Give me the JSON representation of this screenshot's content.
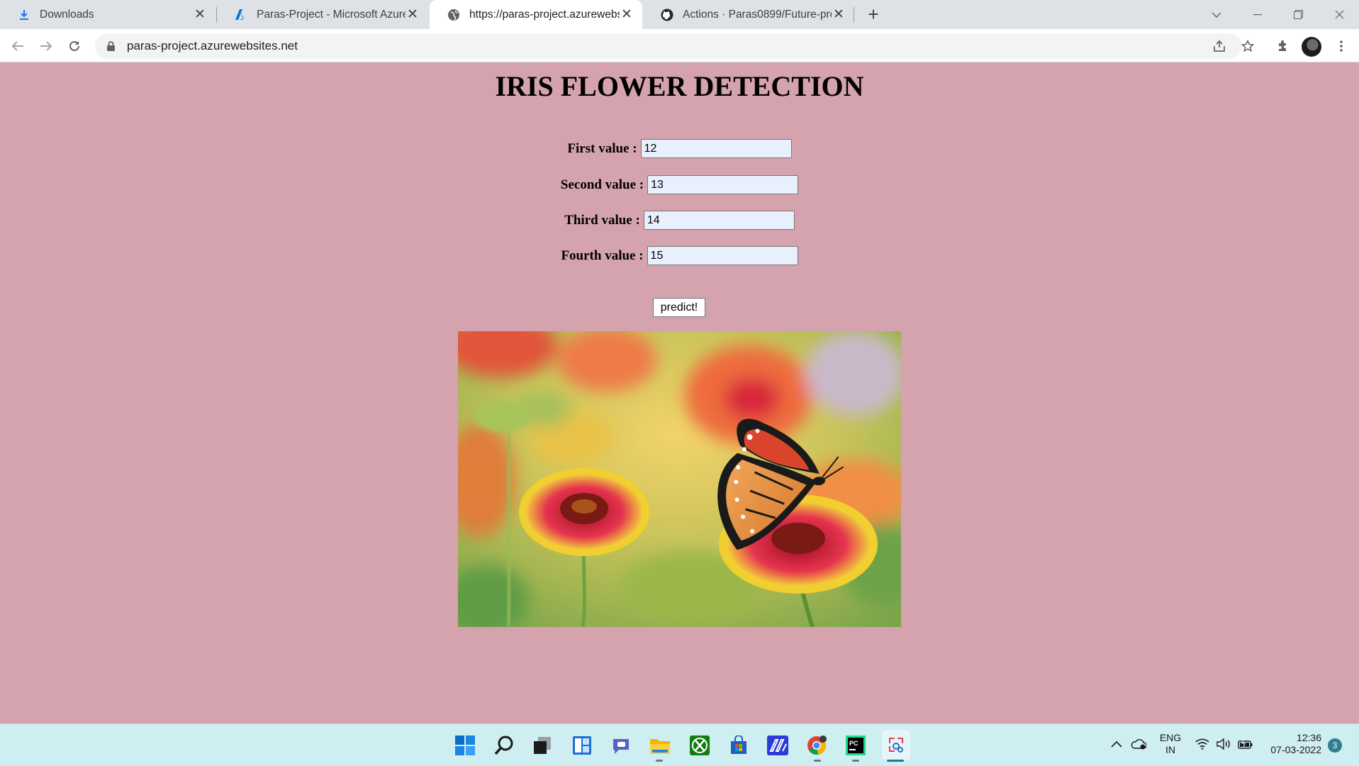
{
  "browser": {
    "tabs": [
      {
        "title": "Downloads",
        "favicon": "download-icon"
      },
      {
        "title": "Paras-Project - Microsoft Azure",
        "favicon": "azure-icon"
      },
      {
        "title": "https://paras-project.azurewebsit",
        "favicon": "globe-icon",
        "active": true
      },
      {
        "title": "Actions · Paras0899/Future-proje",
        "favicon": "github-icon"
      }
    ],
    "url": "paras-project.azurewebsites.net"
  },
  "page": {
    "title": "IRIS FLOWER DETECTION",
    "fields": [
      {
        "label": "First value :",
        "value": "12"
      },
      {
        "label": "Second value :",
        "value": "13"
      },
      {
        "label": "Third value :",
        "value": "14"
      },
      {
        "label": "Fourth value :",
        "value": "15"
      }
    ],
    "predict_label": "predict!",
    "image_alt": "butterfly on flowers"
  },
  "taskbar": {
    "apps": [
      "windows-start-icon",
      "search-icon",
      "task-view-icon",
      "widgets-icon",
      "teams-chat-icon",
      "file-explorer-icon",
      "xbox-icon",
      "store-icon",
      "vscode-like-icon",
      "chrome-icon",
      "pycharm-icon",
      "snipping-tool-icon"
    ],
    "lang_top": "ENG",
    "lang_bottom": "IN",
    "time": "12:36",
    "date": "07-03-2022",
    "notifications": "3"
  },
  "colors": {
    "page_bg": "#d5a3ae",
    "taskbar_bg": "#cfeef2",
    "input_bg": "#e8f0fe"
  }
}
